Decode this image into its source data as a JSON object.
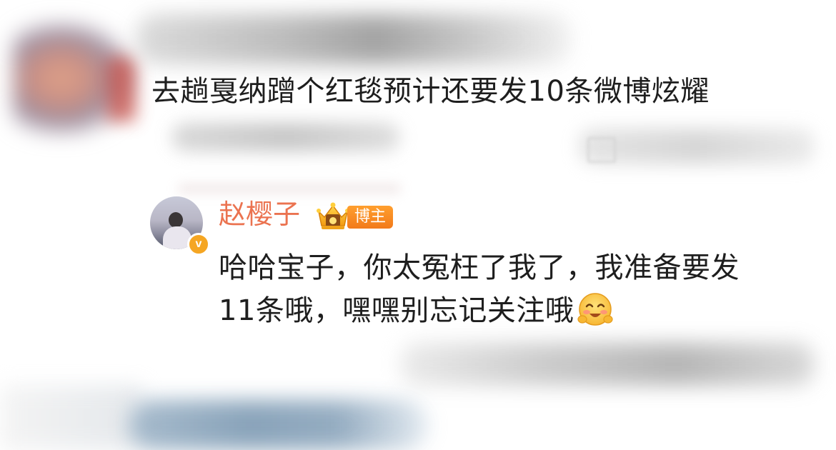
{
  "top_comment": {
    "text": "去趟戛纳蹭个红毯预计还要发10条微博炫耀"
  },
  "reply": {
    "username": "赵樱子",
    "badge_label": "博主",
    "verified_mark": "v",
    "text_line1": "哈哈宝子，你太冤枉了我了，我准备要发",
    "text_line2": "11条哦，嘿嘿别忘记关注哦",
    "emoji": "smile-blush-emoji"
  },
  "colors": {
    "username": "#eb7350",
    "badge_bg": "#f27a1a",
    "verified_bg": "#f5a623",
    "text": "#1e1e1e"
  }
}
